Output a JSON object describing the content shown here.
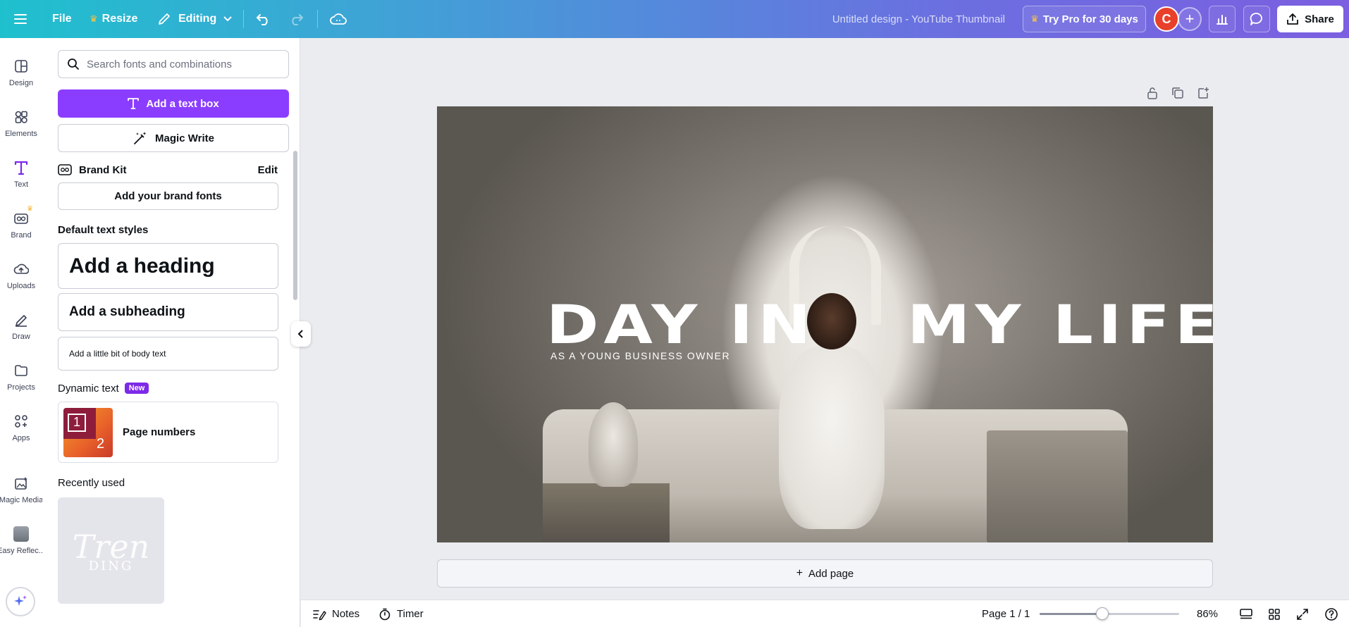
{
  "topbar": {
    "menu_icon": "hamburger-icon",
    "file_label": "File",
    "resize_label": "Resize",
    "editing_label": "Editing",
    "doc_title": "Untitled design - YouTube Thumbnail",
    "pro_label": "Try Pro for 30 days",
    "avatar_initial": "C",
    "share_label": "Share"
  },
  "rail": {
    "items": [
      {
        "label": "Design",
        "icon": "layout-icon"
      },
      {
        "label": "Elements",
        "icon": "shapes-icon"
      },
      {
        "label": "Text",
        "icon": "text-T-icon"
      },
      {
        "label": "Brand",
        "icon": "brand-icon"
      },
      {
        "label": "Uploads",
        "icon": "cloud-upload-icon"
      },
      {
        "label": "Draw",
        "icon": "pen-icon"
      },
      {
        "label": "Projects",
        "icon": "folder-icon"
      },
      {
        "label": "Apps",
        "icon": "apps-icon"
      },
      {
        "label": "Magic Media",
        "icon": "magic-media-icon"
      },
      {
        "label": "Easy Reflec...",
        "icon": "app-thumbnail-icon"
      }
    ]
  },
  "panel": {
    "search_placeholder": "Search fonts and combinations",
    "add_textbox_label": "Add a text box",
    "magic_write_label": "Magic Write",
    "brand_kit_label": "Brand Kit",
    "brand_kit_edit": "Edit",
    "add_brand_fonts": "Add your brand fonts",
    "default_styles_title": "Default text styles",
    "heading_label": "Add a heading",
    "subheading_label": "Add a subheading",
    "body_label": "Add a little bit of body text",
    "dynamic_text_title": "Dynamic text",
    "new_badge": "New",
    "page_numbers_label": "Page numbers",
    "page_numbers_thumb": [
      "1",
      "2"
    ],
    "recently_used_title": "Recently used",
    "recent_thumb_text": [
      "Tren",
      "DING"
    ]
  },
  "canvas": {
    "headline_left": "DAY IN",
    "headline_right": "MY LIFE",
    "subtitle": "AS A YOUNG BUSINESS OWNER",
    "add_page_label": "Add page"
  },
  "bottombar": {
    "notes_label": "Notes",
    "timer_label": "Timer",
    "page_indicator": "Page 1 / 1",
    "zoom_label": "86%",
    "zoom_fraction": 0.45
  },
  "colors": {
    "accent_purple": "#8b3dff",
    "avatar_red": "#e8402a",
    "new_badge": "#7d2ae8"
  }
}
